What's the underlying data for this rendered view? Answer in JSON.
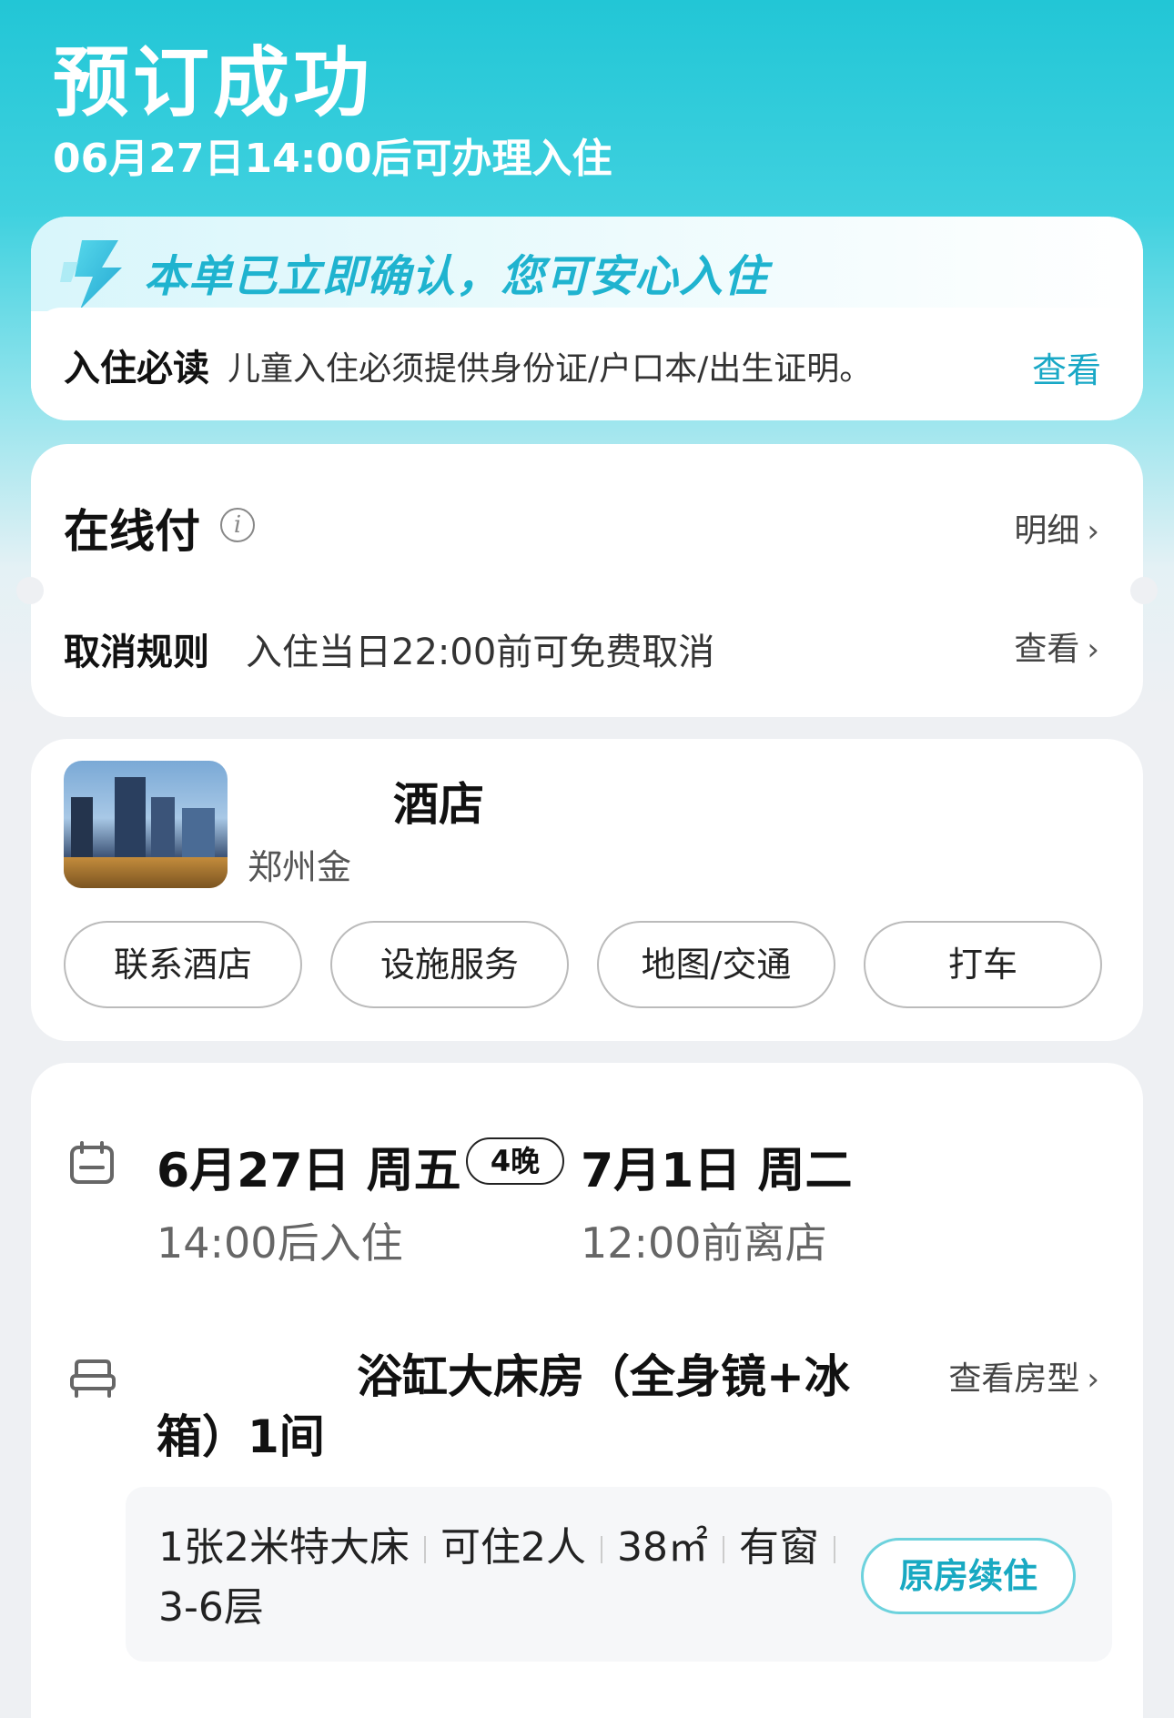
{
  "header": {
    "title": "预订成功",
    "subtitle": "06月27日14:00后可办理入住"
  },
  "confirmation": {
    "banner_text": "本单已立即确认，您可安心入住",
    "notice_label": "入住必读",
    "notice_text": "儿童入住必须提供身份证/户口本/出生证明。",
    "notice_link": "查看"
  },
  "payment": {
    "title": "在线付",
    "detail_link": "明细",
    "cancel_label": "取消规则",
    "cancel_text": "入住当日22:00前可免费取消",
    "cancel_link": "查看"
  },
  "hotel": {
    "name": "酒店",
    "address": "郑州金",
    "buttons": [
      "联系酒店",
      "设施服务",
      "地图/交通",
      "打车"
    ]
  },
  "stay": {
    "checkin_date": "6月27日 周五",
    "nights": "4晚",
    "checkout_date": "7月1日 周二",
    "checkin_time": "14:00后入住",
    "checkout_time": "12:00前离店",
    "room_name": "浴缸大床房（全身镜+冰箱）1间",
    "room_link": "查看房型",
    "specs": [
      "1张2米特大床",
      "可住2人",
      "38㎡",
      "有窗"
    ],
    "floor": "3-6层",
    "renew_button": "原房续住"
  },
  "colors": {
    "accent": "#19a8c6",
    "hero_top": "#22c6d6"
  }
}
